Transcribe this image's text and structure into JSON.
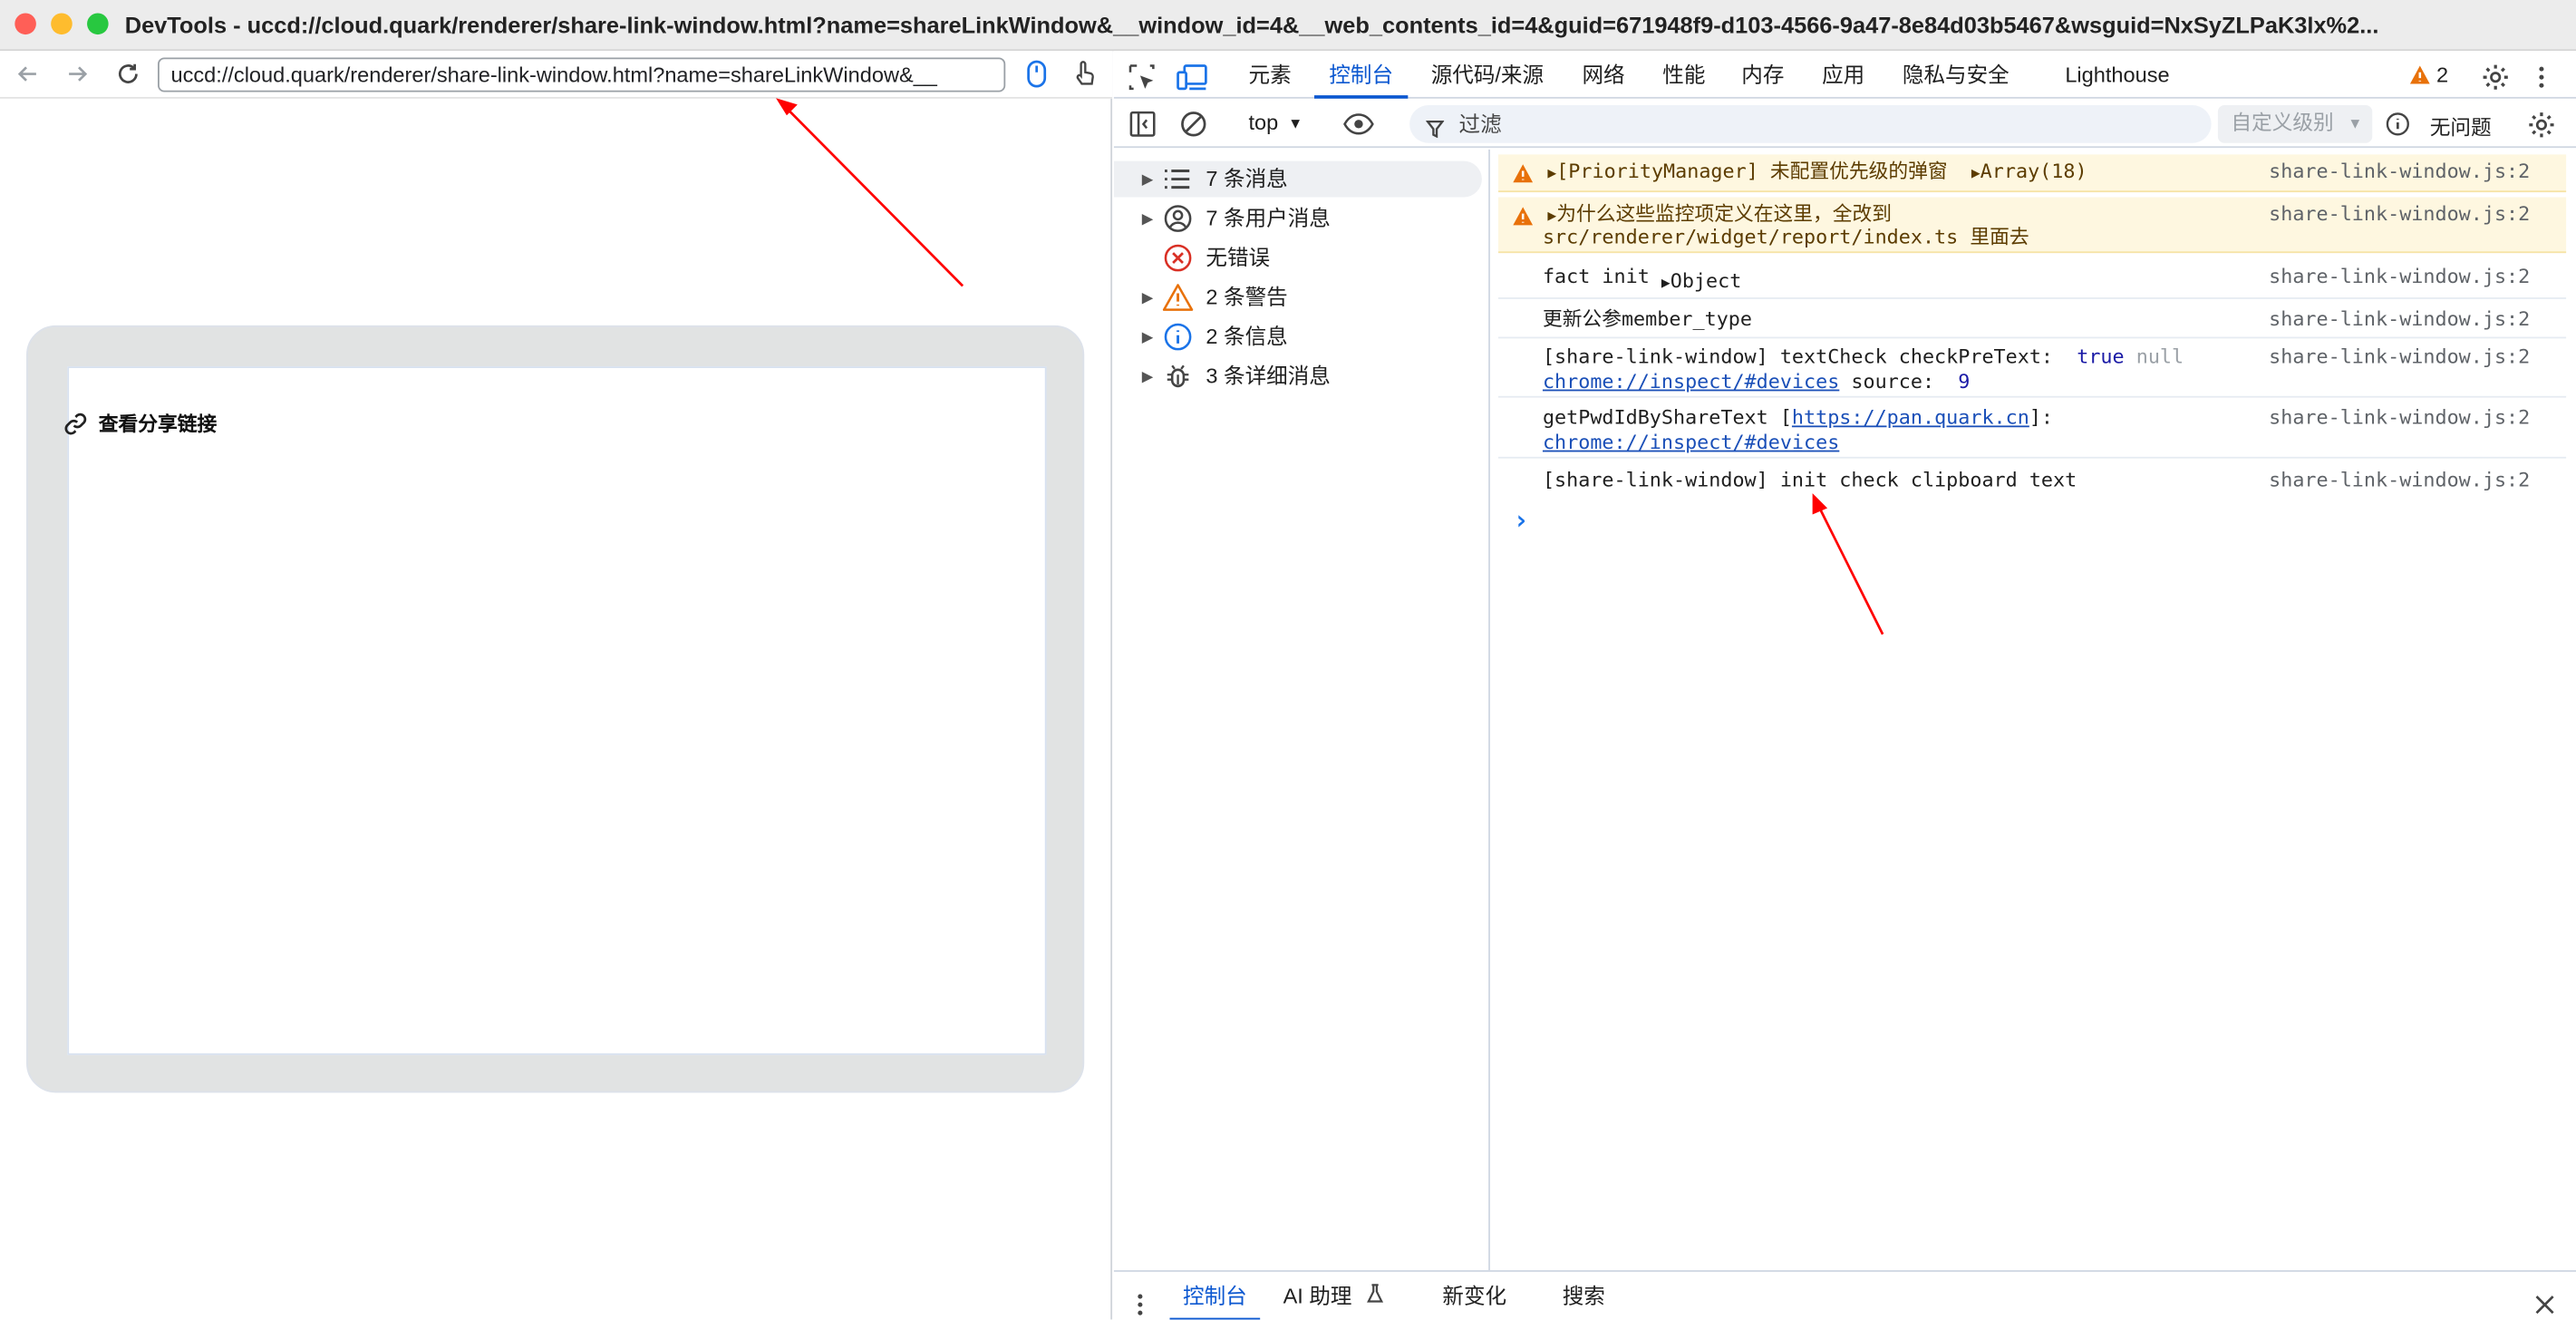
{
  "window": {
    "title": "DevTools - uccd://cloud.quark/renderer/share-link-window.html?name=shareLinkWindow&__window_id=4&__web_contents_id=4&guid=671948f9-d103-4566-9a47-8e84d03b5467&wsguid=NxSyZLPaK3lx%2..."
  },
  "browser": {
    "url": "uccd://cloud.quark/renderer/share-link-window.html?name=shareLinkWindow&__"
  },
  "page": {
    "card_title": "查看分享链接"
  },
  "devtools": {
    "tabs": [
      "元素",
      "控制台",
      "源代码/来源",
      "网络",
      "性能",
      "内存",
      "应用",
      "隐私与安全",
      "Lighthouse"
    ],
    "active_tab": "控制台",
    "issue_count": "2",
    "context": "top",
    "filter_placeholder": "过滤",
    "level_select": "自定义级别",
    "issues_label": "无问题",
    "sidebar": [
      {
        "label": "7 条消息",
        "icon": "list-icon"
      },
      {
        "label": "7 条用户消息",
        "icon": "user-icon"
      },
      {
        "label": "无错误",
        "icon": "error-icon"
      },
      {
        "label": "2 条警告",
        "icon": "warning-icon"
      },
      {
        "label": "2 条信息",
        "icon": "info-icon"
      },
      {
        "label": "3 条详细消息",
        "icon": "bug-icon"
      }
    ],
    "console": [
      {
        "level": "warning",
        "text": "[PriorityManager] 未配置优先级的弹窗",
        "arg": "Array(18)",
        "source": "share-link-window.js:2"
      },
      {
        "level": "warning",
        "text": "为什么这些监控项定义在这里，全改到",
        "text2": "src/renderer/widget/report/index.ts 里面去",
        "source": "share-link-window.js:2"
      },
      {
        "level": "log",
        "text": "fact init",
        "arg": "Object",
        "source": "share-link-window.js:2"
      },
      {
        "level": "log",
        "text": "更新公参member_type",
        "source": "share-link-window.js:2"
      },
      {
        "level": "log",
        "text": "[share-link-window] textCheck checkPreText:",
        "val1": "true",
        "val2": "null",
        "link": "chrome://inspect/#devices",
        "tail": "source:",
        "num": "9",
        "source": "share-link-window.js:2"
      },
      {
        "level": "log",
        "text": "getPwdIdByShareText [",
        "url": "https://pan.quark.cn",
        "text_end": "]:",
        "link": "chrome://inspect/#devices",
        "source": "share-link-window.js:2"
      },
      {
        "level": "log",
        "text": "[share-link-window] init check clipboard text",
        "source": "share-link-window.js:2"
      }
    ],
    "prompt": "›",
    "drawer": {
      "tabs": [
        "控制台",
        "AI 助理",
        "新变化",
        "搜索"
      ],
      "active": "控制台"
    }
  },
  "colors": {
    "accent": "#0b57d0",
    "warning_bg": "#fef7e0",
    "annotation_arrow": "#ff0000"
  }
}
